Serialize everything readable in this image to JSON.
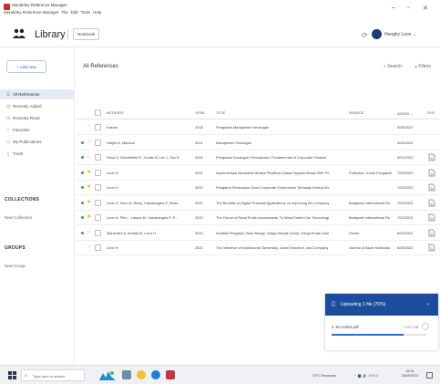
{
  "window": {
    "title": "Mendeley Reference Manager",
    "menu": [
      "Mendeley Reference Manager",
      "File",
      "Edit",
      "Tools",
      "Help"
    ],
    "minimize": "–",
    "maximize": "▫",
    "close": "✕"
  },
  "header": {
    "library_label": "Library",
    "notebook_label": "Notebook",
    "user_name": "Hengky Leon"
  },
  "sidebar": {
    "add_new": "+ Add new",
    "items": [
      {
        "label": "All References",
        "icon": "list-icon",
        "glyph": "☰",
        "active": true
      },
      {
        "label": "Recently Added",
        "icon": "clock-icon",
        "glyph": "◷",
        "active": false
      },
      {
        "label": "Recently Read",
        "icon": "clock-icon",
        "glyph": "◷",
        "active": false
      },
      {
        "label": "Favorites",
        "icon": "star-icon",
        "glyph": "☆",
        "active": false
      },
      {
        "label": "My Publications",
        "icon": "document-icon",
        "glyph": "▭",
        "active": false
      },
      {
        "label": "Trash",
        "icon": "trash-icon",
        "glyph": "▯",
        "active": false
      }
    ],
    "collections_heading": "COLLECTIONS",
    "new_collection": "New Collection",
    "groups_heading": "GROUPS",
    "new_group": "New Group"
  },
  "main": {
    "title": "All References",
    "search_label": "Search",
    "filters_label": "Filters",
    "columns": {
      "authors": "AUTHORS",
      "year": "YEAR",
      "title": "TITLE",
      "source": "SOURCE",
      "added": "ADDED",
      "file": "FILE"
    },
    "rows": [
      {
        "unread": false,
        "starred": false,
        "authors": "Kasmir",
        "year": "2018",
        "title": "Pengantar Manajemen Keuangan",
        "source": "",
        "added": "9/25/2022",
        "has_file": false
      },
      {
        "unread": true,
        "starred": false,
        "authors": "Harjito A, Martono",
        "year": "2021",
        "title": "Manajemen Keuangan",
        "source": "",
        "added": "9/25/2022",
        "has_file": false
      },
      {
        "unread": true,
        "starred": false,
        "authors": "Rosa S, Westerfield R, Jordan B, Lim J, Tan R",
        "year": "2015",
        "title": "Pengantar Keuangan Perusahaan, Fundamental of Corporate Finance",
        "source": "",
        "added": "9/21/2022",
        "has_file": true
      },
      {
        "unread": true,
        "starred": true,
        "authors": "Leon H",
        "year": "2022",
        "title": "Implementasi Akuntansi Melalui Pelatihan Dasar Kepada Siswa SMP Pe",
        "source": "Portfolios: Jurnal Pengabdi",
        "added": "7/20/2022",
        "has_file": true
      },
      {
        "unread": true,
        "starred": true,
        "authors": "Leon H",
        "year": "2019",
        "title": "Pengaruh Penerapan Good Corporate Governance Terhadap Kinerja Ke",
        "source": "",
        "added": "7/20/2022",
        "has_file": true
      },
      {
        "unread": true,
        "starred": true,
        "authors": "Leon H, Heru M, Ricky, Cakranegara P, Setia...",
        "year": "2022",
        "title": "The Benefits of Digital Financial Applications on Improving the Company",
        "source": "Budapest International Re",
        "added": "7/20/2022",
        "has_file": true
      },
      {
        "unread": true,
        "starred": true,
        "authors": "Leon H, Pilri L, Latupa M, Cakranegara P, P...",
        "year": "2022",
        "title": "The Future of Rural Public Accountants: To What Extent Can Technologi",
        "source": "Budapest International Re",
        "added": "7/20/2022",
        "has_file": true
      },
      {
        "unread": true,
        "starred": false,
        "authors": "Mahendra A, Amalia M, Leon H",
        "year": "2022",
        "title": "Analisis Pengaruh Suku Bunga, Harga Minyak Dunia, Harga Emas Duni",
        "source": "Owner",
        "added": "6/30/2022",
        "has_file": true
      },
      {
        "unread": false,
        "starred": false,
        "authors": "Leon H",
        "year": "2022",
        "title": "The Influence of Institutional Ownership, Asset Structure, and Company",
        "source": "Journal of Asian Multicultu",
        "added": "6/30/2022",
        "has_file": true
      }
    ]
  },
  "upload": {
    "title": "Uploading 1 file (76%)",
    "file_name": "4. bs Acitest.pdf",
    "file_size": "714.1 KB",
    "progress": 0.76
  },
  "taskbar": {
    "search_placeholder": "Type here to search",
    "weather": "29°C Berawan",
    "tray": "^ ▆ 🔊 ENG",
    "time": "16:31",
    "date": "28/09/2022"
  },
  "colors": {
    "accent": "#1c4c9c",
    "star": "#f0b400",
    "unread_dot": "#2ca65a",
    "active_row": "#e4ebf5"
  }
}
